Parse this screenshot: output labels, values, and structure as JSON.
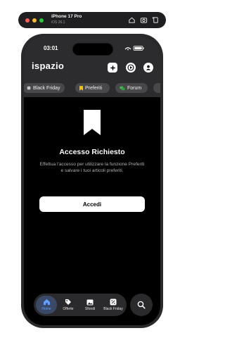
{
  "simulator": {
    "device_name": "iPhone 17 Pro",
    "os_version": "iOS 26.1"
  },
  "status_bar": {
    "time": "03:01"
  },
  "app": {
    "logo_text": "ispazio"
  },
  "chips": [
    {
      "label": "Black Friday",
      "icon": "tag-icon"
    },
    {
      "label": "Preferiti",
      "icon": "bookmark-icon"
    },
    {
      "label": "Forum",
      "icon": "chat-icon"
    }
  ],
  "content": {
    "title": "Accesso Richiesto",
    "description": "Effettua l'accesso per utilizzare la funzione Preferiti e salvare i tuoi articoli preferiti.",
    "button_label": "Accedi"
  },
  "tabbar": {
    "items": [
      {
        "label": "Home",
        "icon": "home-icon",
        "active": true
      },
      {
        "label": "Offerte",
        "icon": "tag-icon",
        "active": false
      },
      {
        "label": "Sfondi",
        "icon": "image-icon",
        "active": false
      },
      {
        "label": "Black Friday",
        "icon": "percent-icon",
        "active": false
      }
    ],
    "search_icon": "search-icon"
  },
  "colors": {
    "accent": "#5fa2ff",
    "header_bg": "#2c2c2e",
    "chip_bg": "#48484a"
  }
}
